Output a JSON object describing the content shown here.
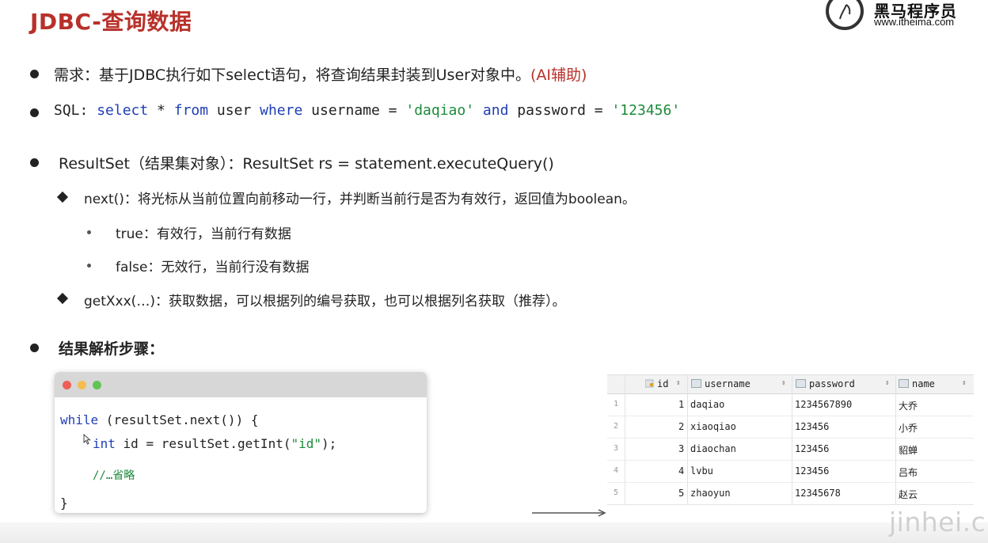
{
  "slide": {
    "title": "JDBC-查询数据",
    "logo_brand": "黑马程序员",
    "logo_url": "www.itheima.com",
    "watermark": "jinhei.cn"
  },
  "bullets": {
    "req_prefix": "需求：基于JDBC执行如下select语句，将查询结果封装到User对象中。",
    "req_ai": "(AI辅助)",
    "sql_label": "SQL: ",
    "sql_select": "select",
    "sql_star": " * ",
    "sql_from": "from",
    "sql_user": " user ",
    "sql_where": "where",
    "sql_cond1": " username = ",
    "sql_val1": "'daqiao'",
    "sql_sp": " ",
    "sql_and": "and",
    "sql_cond2": " password = ",
    "sql_val2": "'123456'",
    "resultset": "ResultSet（结果集对象）：ResultSet rs = statement.executeQuery()",
    "next": "next()：将光标从当前位置向前移动一行，并判断当前行是否为有效行，返回值为boolean。",
    "true_item": "true：有效行，当前行有数据",
    "false_item": "false：无效行，当前行没有数据",
    "getxxx": "getXxx(…)：获取数据，可以根据列的编号获取，也可以根据列名获取（推荐）。",
    "steps": "结果解析步骤："
  },
  "code": {
    "line1_kw": "while",
    "line1_rest": " (resultSet.next()) {",
    "line2_kw": "int",
    "line2_rest": " id = resultSet.getInt(",
    "line2_str": "\"id\"",
    "line2_end": ");",
    "comment": "//…省略",
    "close": "}"
  },
  "db_table": {
    "columns": [
      "id",
      "username",
      "password",
      "name"
    ],
    "rows": [
      {
        "num": "1",
        "id": "1",
        "username": "daqiao",
        "password": "1234567890",
        "name": "大乔"
      },
      {
        "num": "2",
        "id": "2",
        "username": "xiaoqiao",
        "password": "123456",
        "name": "小乔"
      },
      {
        "num": "3",
        "id": "3",
        "username": "diaochan",
        "password": "123456",
        "name": "貂蝉"
      },
      {
        "num": "4",
        "id": "4",
        "username": "lvbu",
        "password": "123456",
        "name": "吕布"
      },
      {
        "num": "5",
        "id": "5",
        "username": "zhaoyun",
        "password": "12345678",
        "name": "赵云"
      }
    ]
  },
  "colors": {
    "title": "#b8312a",
    "keyword": "#1f3fb5",
    "string": "#1d8a3a"
  },
  "icons": [
    "cursor-icon",
    "arrow-icon",
    "key-icon",
    "column-icon",
    "sort-icon",
    "traffic-light-icon"
  ]
}
